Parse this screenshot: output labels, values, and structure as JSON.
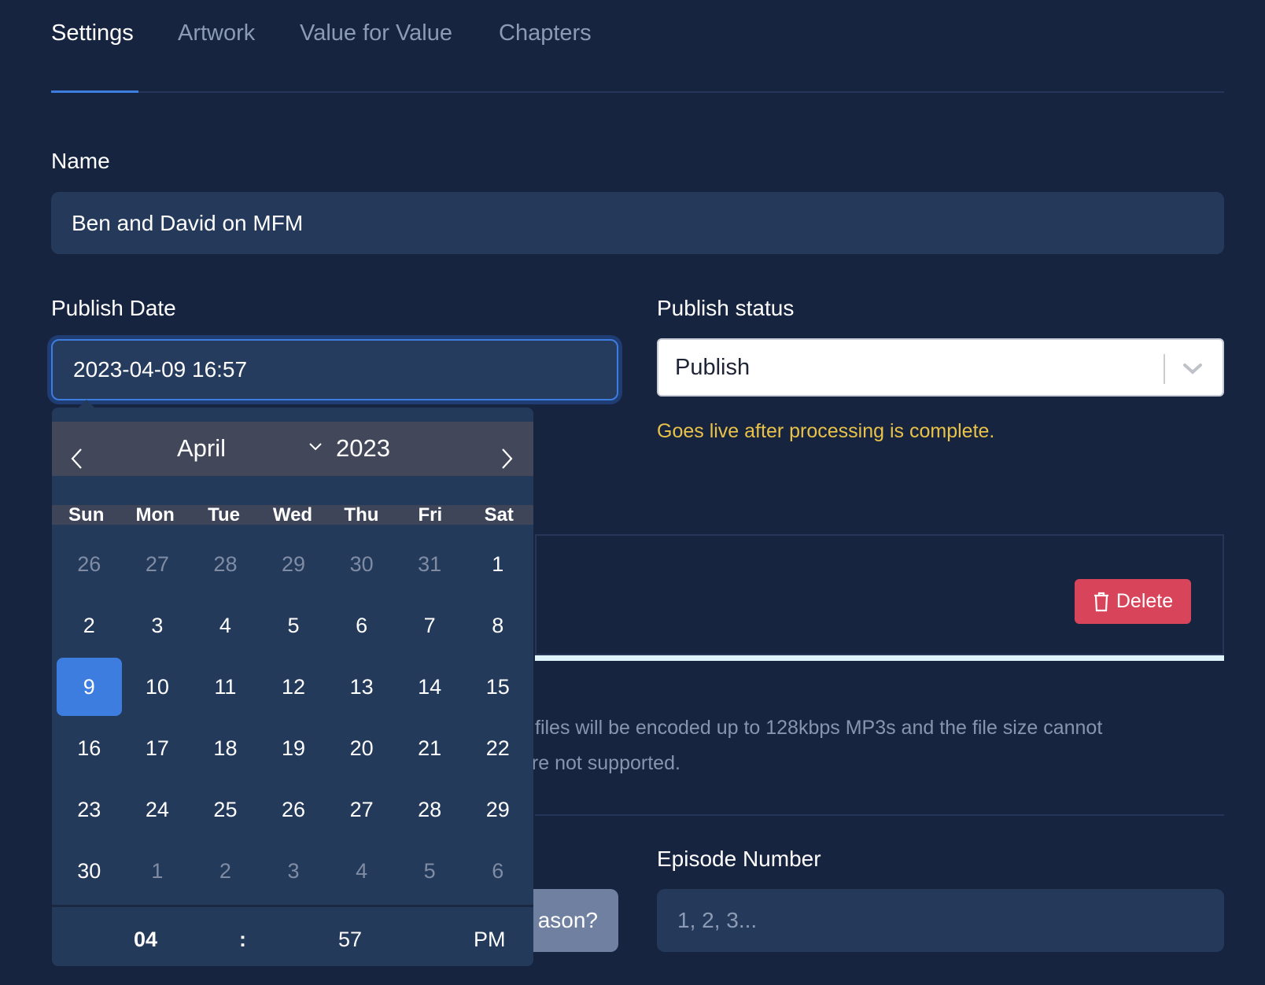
{
  "tabs": [
    {
      "label": "Settings",
      "active": true
    },
    {
      "label": "Artwork"
    },
    {
      "label": "Value for Value"
    },
    {
      "label": "Chapters"
    }
  ],
  "name": {
    "label": "Name",
    "value": "Ben and David on MFM"
  },
  "publish_date": {
    "label": "Publish Date",
    "value": "2023-04-09 16:57"
  },
  "publish_status": {
    "label": "Publish status",
    "value": "Publish",
    "helper": "Goes live after processing is complete.",
    "helper_color": "#e9c248"
  },
  "calendar": {
    "month": "April",
    "year": "2023",
    "weekdays": [
      "Sun",
      "Mon",
      "Tue",
      "Wed",
      "Thu",
      "Fri",
      "Sat"
    ],
    "weeks": [
      [
        "26",
        "27",
        "28",
        "29",
        "30",
        "31",
        "1"
      ],
      [
        "2",
        "3",
        "4",
        "5",
        "6",
        "7",
        "8"
      ],
      [
        "9",
        "10",
        "11",
        "12",
        "13",
        "14",
        "15"
      ],
      [
        "16",
        "17",
        "18",
        "19",
        "20",
        "21",
        "22"
      ],
      [
        "23",
        "24",
        "25",
        "26",
        "27",
        "28",
        "29"
      ],
      [
        "30",
        "1",
        "2",
        "3",
        "4",
        "5",
        "6"
      ]
    ],
    "selected": "9",
    "hour": "04",
    "separator": ":",
    "minute": "57",
    "ampm": "PM",
    "selected_color": "#3d7de0"
  },
  "audio": {
    "delete_label": "Delete",
    "help_line1": "files will be encoded up to 128kbps MP3s and the file size cannot",
    "help_line2": "are not supported.",
    "delete_color": "#d8445a"
  },
  "season_button": {
    "label": "ason?"
  },
  "episode_number": {
    "label": "Episode Number",
    "placeholder": "1, 2, 3..."
  }
}
